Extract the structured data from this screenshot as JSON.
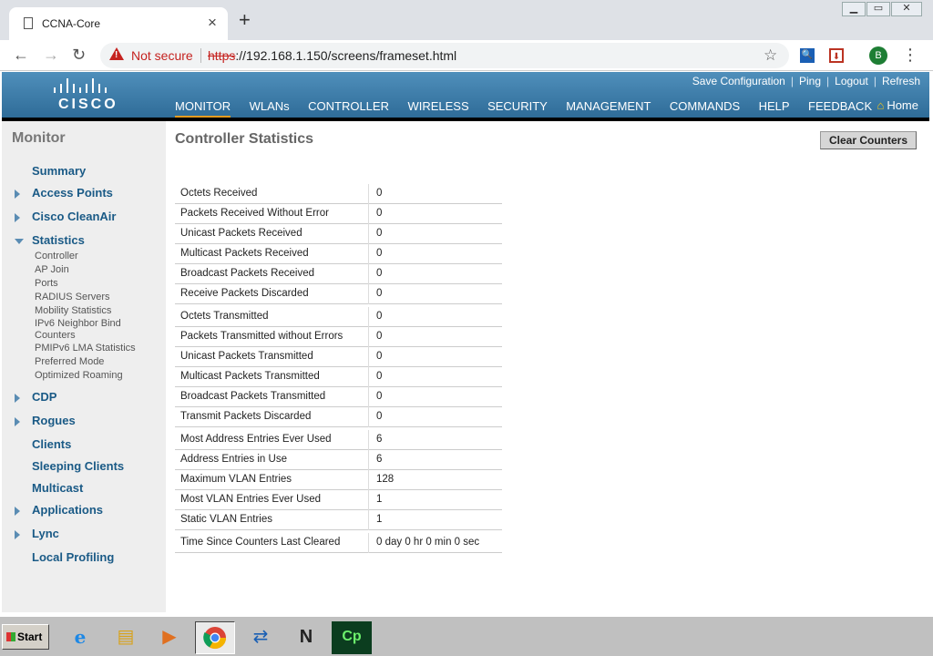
{
  "browser": {
    "tab_title": "CCNA-Core",
    "security_label": "Not secure",
    "url_scheme": "https",
    "url_rest": "://192.168.1.150/screens/frameset.html",
    "profile_initial": "B"
  },
  "header": {
    "top_links": [
      "Save Configuration",
      "Ping",
      "Logout",
      "Refresh"
    ],
    "logo_text": "CISCO",
    "nav": [
      "MONITOR",
      "WLANs",
      "CONTROLLER",
      "WIRELESS",
      "SECURITY",
      "MANAGEMENT",
      "COMMANDS",
      "HELP",
      "FEEDBACK"
    ],
    "active_nav": "MONITOR",
    "home_label": "Home"
  },
  "sidebar": {
    "title": "Monitor",
    "items": [
      "Summary",
      "Access Points",
      "Cisco CleanAir",
      "Statistics",
      "CDP",
      "Rogues",
      "Clients",
      "Sleeping Clients",
      "Multicast",
      "Applications",
      "Lync",
      "Local Profiling"
    ],
    "statistics_sub": [
      "Controller",
      "AP Join",
      "Ports",
      "RADIUS Servers",
      "Mobility Statistics",
      "IPv6 Neighbor Bind",
      "Counters",
      "PMIPv6 LMA Statistics",
      "Preferred Mode",
      "Optimized Roaming"
    ]
  },
  "main": {
    "title": "Controller Statistics",
    "clear_button": "Clear Counters",
    "stats": [
      {
        "label": "Octets Received",
        "value": "0"
      },
      {
        "label": "Packets Received Without Error",
        "value": "0"
      },
      {
        "label": "Unicast Packets Received",
        "value": "0"
      },
      {
        "label": "Multicast Packets Received",
        "value": "0"
      },
      {
        "label": "Broadcast Packets Received",
        "value": "0"
      },
      {
        "label": "Receive Packets Discarded",
        "value": "0"
      },
      {
        "label": "Octets Transmitted",
        "value": "0"
      },
      {
        "label": "Packets Transmitted without Errors",
        "value": "0"
      },
      {
        "label": "Unicast Packets Transmitted",
        "value": "0"
      },
      {
        "label": "Multicast Packets Transmitted",
        "value": "0"
      },
      {
        "label": "Broadcast Packets Transmitted",
        "value": "0"
      },
      {
        "label": "Transmit Packets Discarded",
        "value": "0"
      },
      {
        "label": "Most Address Entries Ever Used",
        "value": "6"
      },
      {
        "label": "Address Entries in Use",
        "value": "6"
      },
      {
        "label": "Maximum VLAN Entries",
        "value": "128"
      },
      {
        "label": "Most VLAN Entries Ever Used",
        "value": "1"
      },
      {
        "label": "Static VLAN Entries",
        "value": "1"
      },
      {
        "label": "Time Since Counters Last Cleared",
        "value": "0 day 0 hr 0 min 0 sec"
      }
    ]
  },
  "taskbar": {
    "start_label": "Start",
    "icons": [
      "internet-explorer-icon",
      "file-explorer-icon",
      "media-player-icon",
      "chrome-icon",
      "network-icon",
      "n-app-icon",
      "captivate-icon"
    ]
  },
  "colors": {
    "header_blue": "#2f6c98",
    "nav_active_underline": "#e49c21",
    "sidebar_link": "#1a5a86",
    "not_secure_red": "#c5221f"
  }
}
